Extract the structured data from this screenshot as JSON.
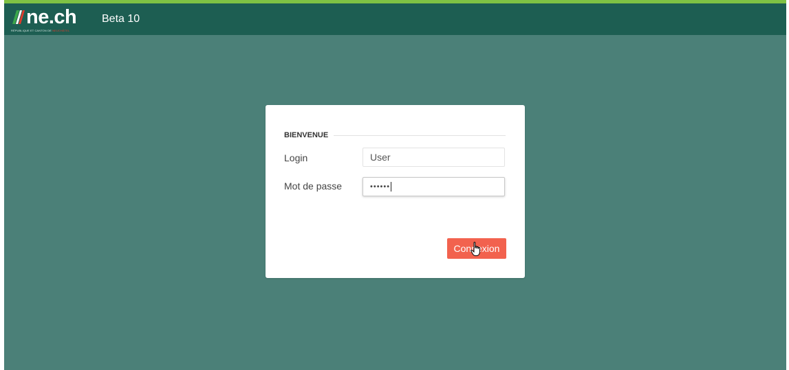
{
  "header": {
    "logo_text": "ne.ch",
    "logo_tagline": "RÉPUBLIQUE ET CANTON DE",
    "logo_tagline_accent": "NEUCHÂTEL",
    "version_label": "Beta 10"
  },
  "login_form": {
    "legend": "BIENVENUE",
    "login_label": "Login",
    "login_value": "User",
    "password_label": "Mot de passe",
    "password_mask": "••••••",
    "submit_label": "Connexion"
  },
  "colors": {
    "accent_bar": "#7fc244",
    "navbar": "#1d5e52",
    "background": "#4b8078",
    "button": "#f2624e"
  },
  "icons": {
    "logo": "neuchatel-flag-icon",
    "cursor": "hand-pointer-icon"
  }
}
